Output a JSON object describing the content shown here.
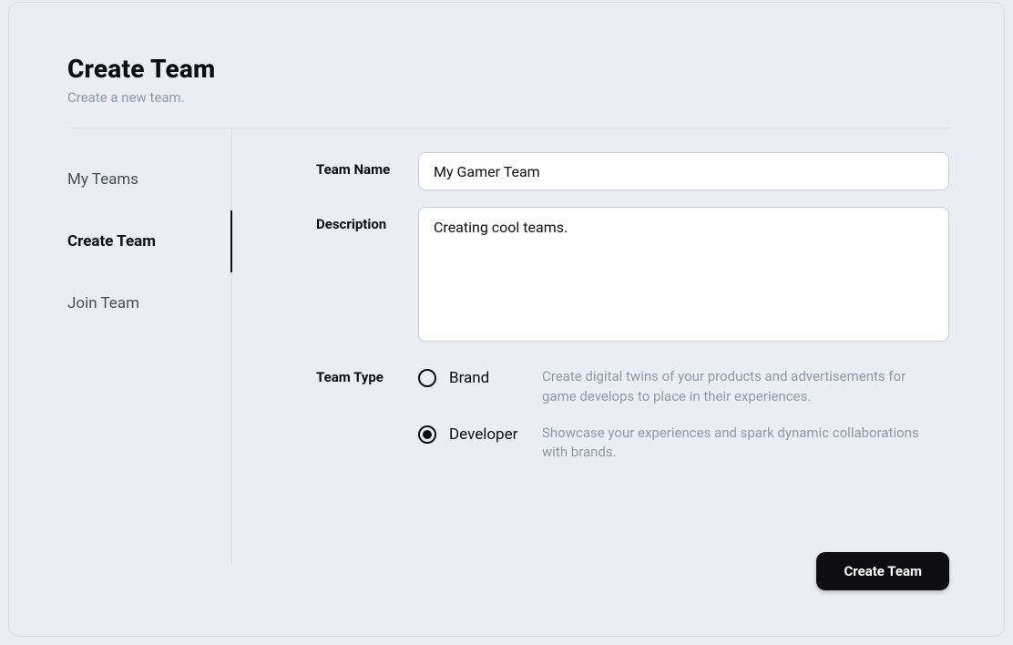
{
  "header": {
    "title": "Create Team",
    "subtitle": "Create a new team."
  },
  "sidebar": {
    "items": [
      {
        "label": "My Teams"
      },
      {
        "label": "Create Team"
      },
      {
        "label": "Join Team"
      }
    ]
  },
  "form": {
    "teamName": {
      "label": "Team Name",
      "value": "My Gamer Team"
    },
    "description": {
      "label": "Description",
      "value": "Creating cool teams."
    },
    "teamType": {
      "label": "Team Type",
      "options": [
        {
          "label": "Brand",
          "description": "Create digital twins of your products and advertisements for game develops to place in their experiences."
        },
        {
          "label": "Developer",
          "description": "Showcase your experiences and spark dynamic collaborations with brands."
        }
      ],
      "selected": "Developer"
    },
    "submitLabel": "Create Team"
  }
}
